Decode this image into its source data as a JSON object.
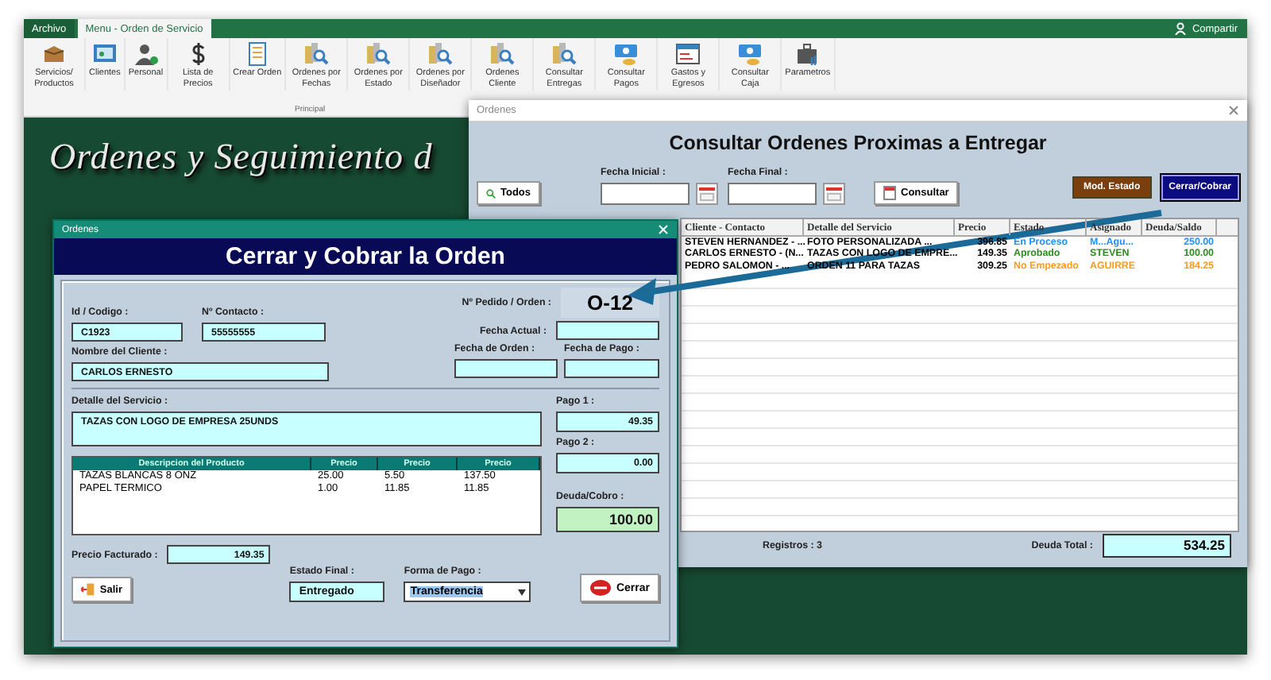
{
  "ribbon_tabs": [
    {
      "label": "Archivo",
      "selected": false
    },
    {
      "label": "Menu - Orden de Servicio",
      "selected": true
    }
  ],
  "share_button": {
    "label": "Compartir"
  },
  "ribbon_groups": [
    {
      "label": "Principal",
      "items": [
        {
          "label": "Servicios/ Productos"
        },
        {
          "label": "Clientes"
        },
        {
          "label": "Personal"
        },
        {
          "label": "Lista de Precios"
        },
        {
          "label": "Crear Orden"
        },
        {
          "label": "Ordenes por Fechas"
        },
        {
          "label": "Ordenes por Estado"
        },
        {
          "label": "Ordenes por Diseñador"
        },
        {
          "label": "Ordenes Cliente"
        },
        {
          "label": "Consultar Entregas"
        }
      ]
    },
    {
      "items": [
        {
          "label": "Consultar Pagos"
        },
        {
          "label": "Gastos y Egresos"
        },
        {
          "label": "Consultar Caja"
        },
        {
          "label": "Parametros"
        }
      ]
    }
  ],
  "sheet_title": "Ordenes y Seguimiento d",
  "consult_dialog": {
    "title": "Ordenes",
    "heading": "Consultar Ordenes Proximas a Entregar",
    "all_button": "Todos",
    "start_date": {
      "label": "Fecha Inicial :"
    },
    "end_date": {
      "label": "Fecha Final :"
    },
    "consult_button": "Consultar",
    "modify_button": "Mod. Estado",
    "close_button": "Cerrar/Cobrar",
    "columns": [
      "Cliente - Contacto",
      "Detalle del Servicio",
      "Precio",
      "Estado",
      "Asignado",
      "Deuda/Saldo"
    ],
    "rows": [
      {
        "client": "STEVEN HERNANDEZ - ...",
        "detail": "FOTO PERSONALIZADA ...",
        "price": "396.85",
        "status": "En Proceso",
        "assigned": "M...Agu...",
        "balance": "250.00",
        "color": "#1e90ff"
      },
      {
        "client": "CARLOS ERNESTO - (N...",
        "detail": "TAZAS CON LOGO DE EMPRE...",
        "price": "149.35",
        "status": "Aprobado",
        "assigned": "STEVEN",
        "balance": "100.00",
        "color": "#2e8b22"
      },
      {
        "client": "PEDRO SALOMON - ...",
        "detail": "ORDEN 11 PARA TAZAS",
        "price": "309.25",
        "status": "No Empezado",
        "assigned": "AGUIRRE",
        "balance": "184.25",
        "color": "#ff9a1a"
      }
    ],
    "records": "Registros : 3",
    "total_label": "Deuda Total :",
    "total": "534.25"
  },
  "close_dialog": {
    "title": "Ordenes",
    "heading": "Cerrar y Cobrar la Orden",
    "id": {
      "label": "Id / Codigo :",
      "value": "C1923"
    },
    "contact": {
      "label": "Nº Contacto :",
      "value": "55555555"
    },
    "order_label": "Nº Pedido / Orden :",
    "order": "O-12",
    "current_date": {
      "label": "Fecha Actual :"
    },
    "client": {
      "label": "Nombre del Cliente :",
      "value": "CARLOS ERNESTO"
    },
    "order_date": {
      "label": "Fecha de Orden :"
    },
    "pay_date": {
      "label": "Fecha de Pago :"
    },
    "detail": {
      "label": "Detalle del Servicio :",
      "value": "TAZAS CON LOGO DE EMPRESA 25UNDS"
    },
    "product_columns": [
      "Descripcion del Producto",
      "Precio",
      "Precio",
      "Precio"
    ],
    "products": [
      [
        "TAZAS BLANCAS 8 ONZ",
        "25.00",
        "5.50",
        "137.50"
      ],
      [
        "PAPEL TERMICO",
        "1.00",
        "11.85",
        "11.85"
      ]
    ],
    "pay1": {
      "label": "Pago 1 :",
      "value": "49.35"
    },
    "pay2": {
      "label": "Pago 2 :",
      "value": "0.00"
    },
    "debt": {
      "label": "Deuda/Cobro :",
      "value": "100.00"
    },
    "billed": {
      "label": "Precio Facturado :",
      "value": "149.35"
    },
    "final_state": {
      "label": "Estado Final :",
      "value": "Entregado"
    },
    "payment": {
      "label": "Forma de Pago :",
      "value": "Transferencia",
      "highlighted": true
    },
    "exit_button": "Salir",
    "close_button": "Cerrar"
  }
}
